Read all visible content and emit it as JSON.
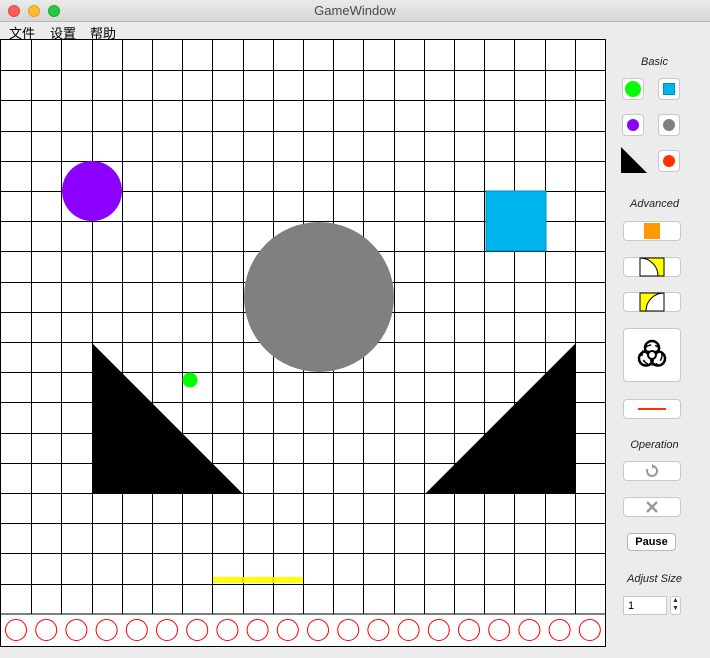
{
  "window": {
    "title": "GameWindow"
  },
  "menu": [
    "文件",
    "设置",
    "帮助"
  ],
  "board": {
    "grid_cols": 20,
    "grid_rows": 19,
    "objects": [
      {
        "name": "purple-circle",
        "color": "#8b00ff"
      },
      {
        "name": "gray-circle",
        "color": "#808080"
      },
      {
        "name": "blue-square",
        "color": "#00b4ed"
      },
      {
        "name": "green-ball",
        "color": "#00ff00"
      },
      {
        "name": "left-triangle",
        "color": "#000000"
      },
      {
        "name": "right-triangle",
        "color": "#000000"
      },
      {
        "name": "yellow-paddle",
        "color": "#ffff00"
      }
    ],
    "bottom_holes": 20,
    "hole_color": "#ff0000"
  },
  "panel": {
    "basic_label": "Basic",
    "advanced_label": "Advanced",
    "operation_label": "Operation",
    "pause_label": "Pause",
    "adjust_size_label": "Adjust Size",
    "size_value": "1"
  }
}
